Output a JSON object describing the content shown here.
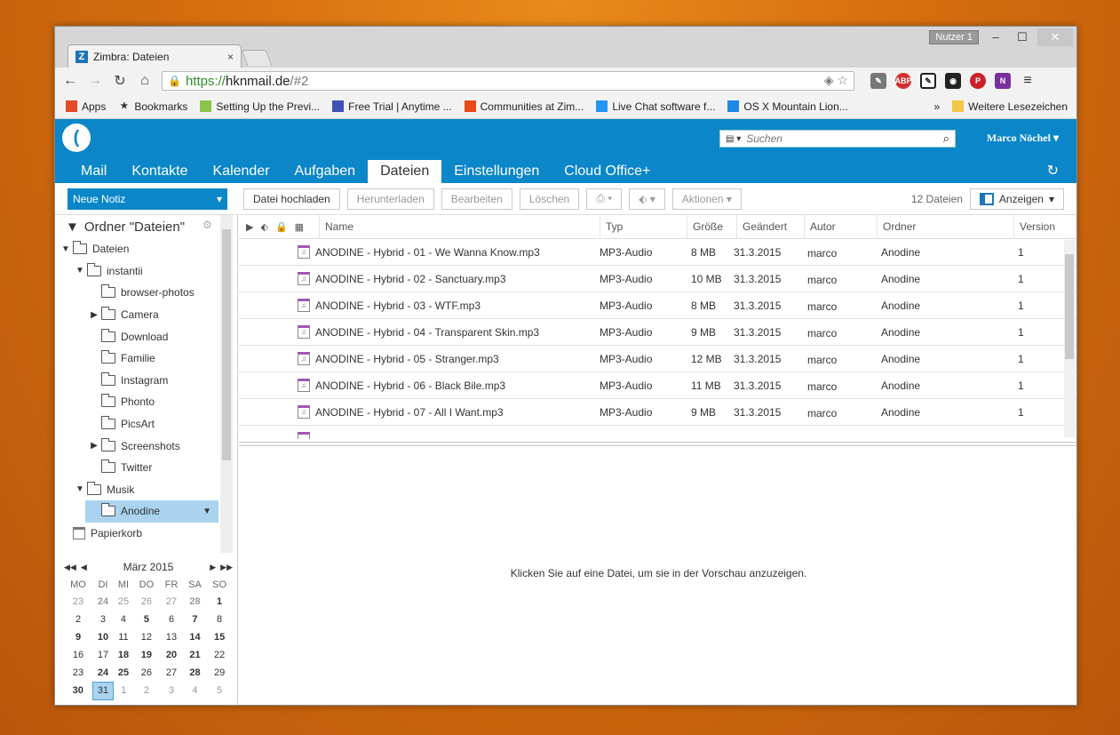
{
  "os": {
    "user_chip": "Nutzer 1",
    "minimize": "–",
    "maximize": "☐",
    "close": "✕"
  },
  "browser": {
    "tab_title": "Zimbra: Dateien",
    "tab_close": "×",
    "url_scheme": "https://",
    "url_host": "hknmail.de",
    "url_path": "/#2",
    "bookmarks": [
      {
        "label": "Apps",
        "color": "#e34c26",
        "icon": "apps-grid-icon"
      },
      {
        "label": "Bookmarks",
        "color": "#333333",
        "icon": "star-icon"
      },
      {
        "label": "Setting Up the Previ...",
        "color": "#8bc34a",
        "icon": "android-icon"
      },
      {
        "label": "Free Trial | Anytime ...",
        "color": "#3f51b5",
        "icon": "a-logo-icon"
      },
      {
        "label": "Communities at Zim...",
        "color": "#e64a19",
        "icon": "z-logo-icon"
      },
      {
        "label": "Live Chat software f...",
        "color": "#2196f3",
        "icon": "chat-bird-icon"
      },
      {
        "label": "OS X Mountain Lion...",
        "color": "#1e88e5",
        "icon": "lightning-icon"
      }
    ],
    "bookmark_overflow": "»",
    "other_bookmarks": "Weitere Lesezeichen"
  },
  "zimbra": {
    "search_placeholder": "Suchen",
    "user_name": "Marco Nöchel",
    "tabs": [
      "Mail",
      "Kontakte",
      "Kalender",
      "Aufgaben",
      "Dateien",
      "Einstellungen",
      "Cloud Office+"
    ],
    "active_tab": "Dateien",
    "new_button": "Neue Notiz",
    "actions": {
      "upload": "Datei hochladen",
      "download": "Herunterladen",
      "edit": "Bearbeiten",
      "delete": "Löschen",
      "more": "Aktionen",
      "file_count": "12 Dateien",
      "show": "Anzeigen"
    },
    "tree_header": "Ordner \"Dateien\"",
    "tree": [
      {
        "label": "Dateien",
        "level": 0,
        "arrow": "▼",
        "selected": false
      },
      {
        "label": "instantii",
        "level": 1,
        "arrow": "▼",
        "selected": false
      },
      {
        "label": "browser-photos",
        "level": 2,
        "arrow": "",
        "selected": false
      },
      {
        "label": "Camera",
        "level": 2,
        "arrow": "▶",
        "selected": false
      },
      {
        "label": "Download",
        "level": 2,
        "arrow": "",
        "selected": false
      },
      {
        "label": "Familie",
        "level": 2,
        "arrow": "",
        "selected": false
      },
      {
        "label": "Instagram",
        "level": 2,
        "arrow": "",
        "selected": false
      },
      {
        "label": "Phonto",
        "level": 2,
        "arrow": "",
        "selected": false
      },
      {
        "label": "PicsArt",
        "level": 2,
        "arrow": "",
        "selected": false
      },
      {
        "label": "Screenshots",
        "level": 2,
        "arrow": "▶",
        "selected": false
      },
      {
        "label": "Twitter",
        "level": 2,
        "arrow": "",
        "selected": false
      },
      {
        "label": "Musik",
        "level": 1,
        "arrow": "▼",
        "selected": false
      },
      {
        "label": "Anodine",
        "level": 2,
        "arrow": "",
        "selected": true
      }
    ],
    "trash": "Papierkorb",
    "calendar": {
      "month": "März 2015",
      "weekdays": [
        "MO",
        "DI",
        "MI",
        "DO",
        "FR",
        "SA",
        "SO"
      ],
      "weeks": [
        [
          [
            "23",
            "dim"
          ],
          [
            "24",
            "dim b"
          ],
          [
            "25",
            "dim"
          ],
          [
            "26",
            "dim"
          ],
          [
            "27",
            "dim"
          ],
          [
            "28",
            "dim b"
          ],
          [
            "1",
            "b"
          ]
        ],
        [
          [
            "2",
            ""
          ],
          [
            "3",
            ""
          ],
          [
            "4",
            ""
          ],
          [
            "5",
            "b"
          ],
          [
            "6",
            ""
          ],
          [
            "7",
            "b"
          ],
          [
            "8",
            ""
          ]
        ],
        [
          [
            "9",
            "b"
          ],
          [
            "10",
            "b"
          ],
          [
            "11",
            ""
          ],
          [
            "12",
            ""
          ],
          [
            "13",
            ""
          ],
          [
            "14",
            "b"
          ],
          [
            "15",
            "b"
          ]
        ],
        [
          [
            "16",
            ""
          ],
          [
            "17",
            ""
          ],
          [
            "18",
            "b"
          ],
          [
            "19",
            "b"
          ],
          [
            "20",
            "b"
          ],
          [
            "21",
            "b"
          ],
          [
            "22",
            ""
          ]
        ],
        [
          [
            "23",
            ""
          ],
          [
            "24",
            "b"
          ],
          [
            "25",
            "b"
          ],
          [
            "26",
            ""
          ],
          [
            "27",
            ""
          ],
          [
            "28",
            "b"
          ],
          [
            "29",
            ""
          ]
        ],
        [
          [
            "30",
            "b"
          ],
          [
            "31",
            "today"
          ],
          [
            "1",
            "dim"
          ],
          [
            "2",
            "dim"
          ],
          [
            "3",
            "dim"
          ],
          [
            "4",
            "dim"
          ],
          [
            "5",
            "dim"
          ]
        ]
      ]
    },
    "columns": {
      "name": "Name",
      "type": "Typ",
      "size": "Größe",
      "modified": "Geändert",
      "author": "Autor",
      "folder": "Ordner",
      "version": "Version"
    },
    "files": [
      {
        "name": "ANODINE - Hybrid - 01 - We Wanna Know.mp3",
        "type": "MP3-Audio",
        "size": "8 MB",
        "date": "31.3.2015",
        "author": "marco",
        "folder": "Anodine",
        "version": "1"
      },
      {
        "name": "ANODINE - Hybrid - 02 - Sanctuary.mp3",
        "type": "MP3-Audio",
        "size": "10 MB",
        "date": "31.3.2015",
        "author": "marco",
        "folder": "Anodine",
        "version": "1"
      },
      {
        "name": "ANODINE - Hybrid - 03 - WTF.mp3",
        "type": "MP3-Audio",
        "size": "8 MB",
        "date": "31.3.2015",
        "author": "marco",
        "folder": "Anodine",
        "version": "1"
      },
      {
        "name": "ANODINE - Hybrid - 04 - Transparent Skin.mp3",
        "type": "MP3-Audio",
        "size": "9 MB",
        "date": "31.3.2015",
        "author": "marco",
        "folder": "Anodine",
        "version": "1"
      },
      {
        "name": "ANODINE - Hybrid - 05 - Stranger.mp3",
        "type": "MP3-Audio",
        "size": "12 MB",
        "date": "31.3.2015",
        "author": "marco",
        "folder": "Anodine",
        "version": "1"
      },
      {
        "name": "ANODINE - Hybrid - 06 - Black Bile.mp3",
        "type": "MP3-Audio",
        "size": "11 MB",
        "date": "31.3.2015",
        "author": "marco",
        "folder": "Anodine",
        "version": "1"
      },
      {
        "name": "ANODINE - Hybrid - 07 - All I Want.mp3",
        "type": "MP3-Audio",
        "size": "9 MB",
        "date": "31.3.2015",
        "author": "marco",
        "folder": "Anodine",
        "version": "1"
      }
    ],
    "preview_hint": "Klicken Sie auf eine Datei, um sie in der Vorschau anzuzeigen."
  }
}
